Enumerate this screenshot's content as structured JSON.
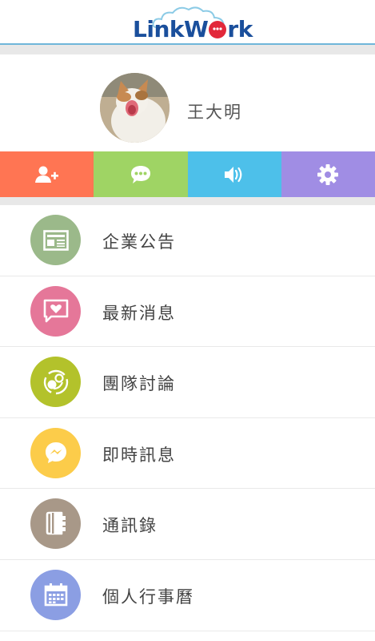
{
  "header": {
    "logo_text_link": "Link",
    "logo_text_w": "W",
    "logo_text_rk": "rk"
  },
  "profile": {
    "name": "王大明"
  },
  "actions": [
    {
      "icon": "add-user-icon",
      "color": "#ff7553"
    },
    {
      "icon": "chat-bubble-icon",
      "color": "#9fd464"
    },
    {
      "icon": "speaker-icon",
      "color": "#4dc0ea"
    },
    {
      "icon": "gear-icon",
      "color": "#a08de4"
    }
  ],
  "menu": [
    {
      "label": "企業公告",
      "icon": "newspaper-icon",
      "color": "#9bb98a"
    },
    {
      "label": "最新消息",
      "icon": "heart-message-icon",
      "color": "#e57799"
    },
    {
      "label": "團隊討論",
      "icon": "discussion-icon",
      "color": "#b3c22b"
    },
    {
      "label": "即時訊息",
      "icon": "messenger-icon",
      "color": "#fccc4a"
    },
    {
      "label": "通訊錄",
      "icon": "address-book-icon",
      "color": "#a89888"
    },
    {
      "label": "個人行事曆",
      "icon": "calendar-icon",
      "color": "#8b9ee3"
    }
  ]
}
